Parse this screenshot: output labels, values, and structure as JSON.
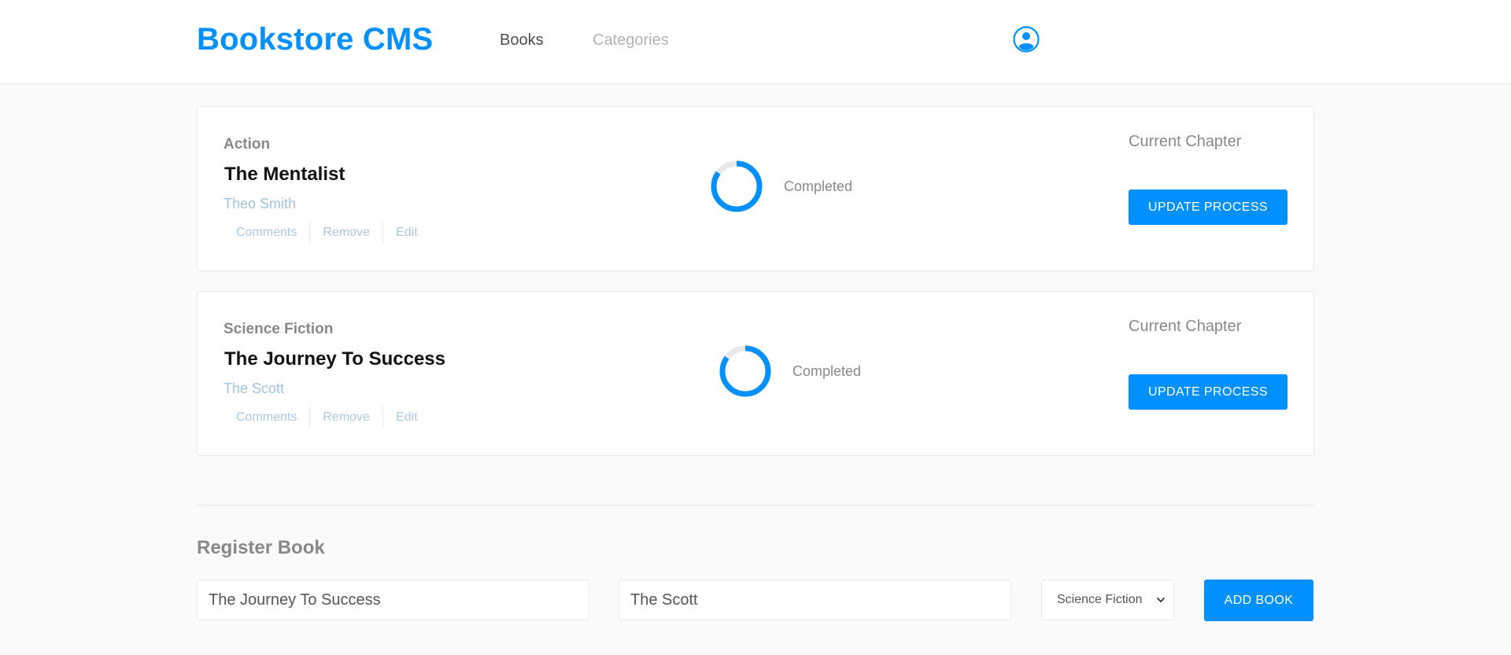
{
  "header": {
    "brand": "Bookstore CMS",
    "nav": {
      "books": "Books",
      "categories": "Categories"
    },
    "user_icon": "user-circle-icon"
  },
  "books": [
    {
      "category": "Action",
      "title": "The Mentalist",
      "author": "Theo Smith",
      "actions": {
        "comments": "Comments",
        "remove": "Remove",
        "edit": "Edit"
      },
      "progress_label": "Completed",
      "progress": 0.85,
      "chapter_label": "Current Chapter",
      "update_label": "UPDATE PROCESS"
    },
    {
      "category": "Science Fiction",
      "title": "The Journey To Success",
      "author": "The Scott",
      "actions": {
        "comments": "Comments",
        "remove": "Remove",
        "edit": "Edit"
      },
      "progress_label": "Completed",
      "progress": 0.85,
      "chapter_label": "Current Chapter",
      "update_label": "UPDATE PROCESS"
    }
  ],
  "form": {
    "title": "Register Book",
    "title_value": "The Journey To Success",
    "author_value": "The Scott",
    "category_selected": "Science Fiction",
    "submit_label": "ADD BOOK"
  },
  "colors": {
    "accent": "#0290ff",
    "progress_track": "#e8e8e8"
  }
}
